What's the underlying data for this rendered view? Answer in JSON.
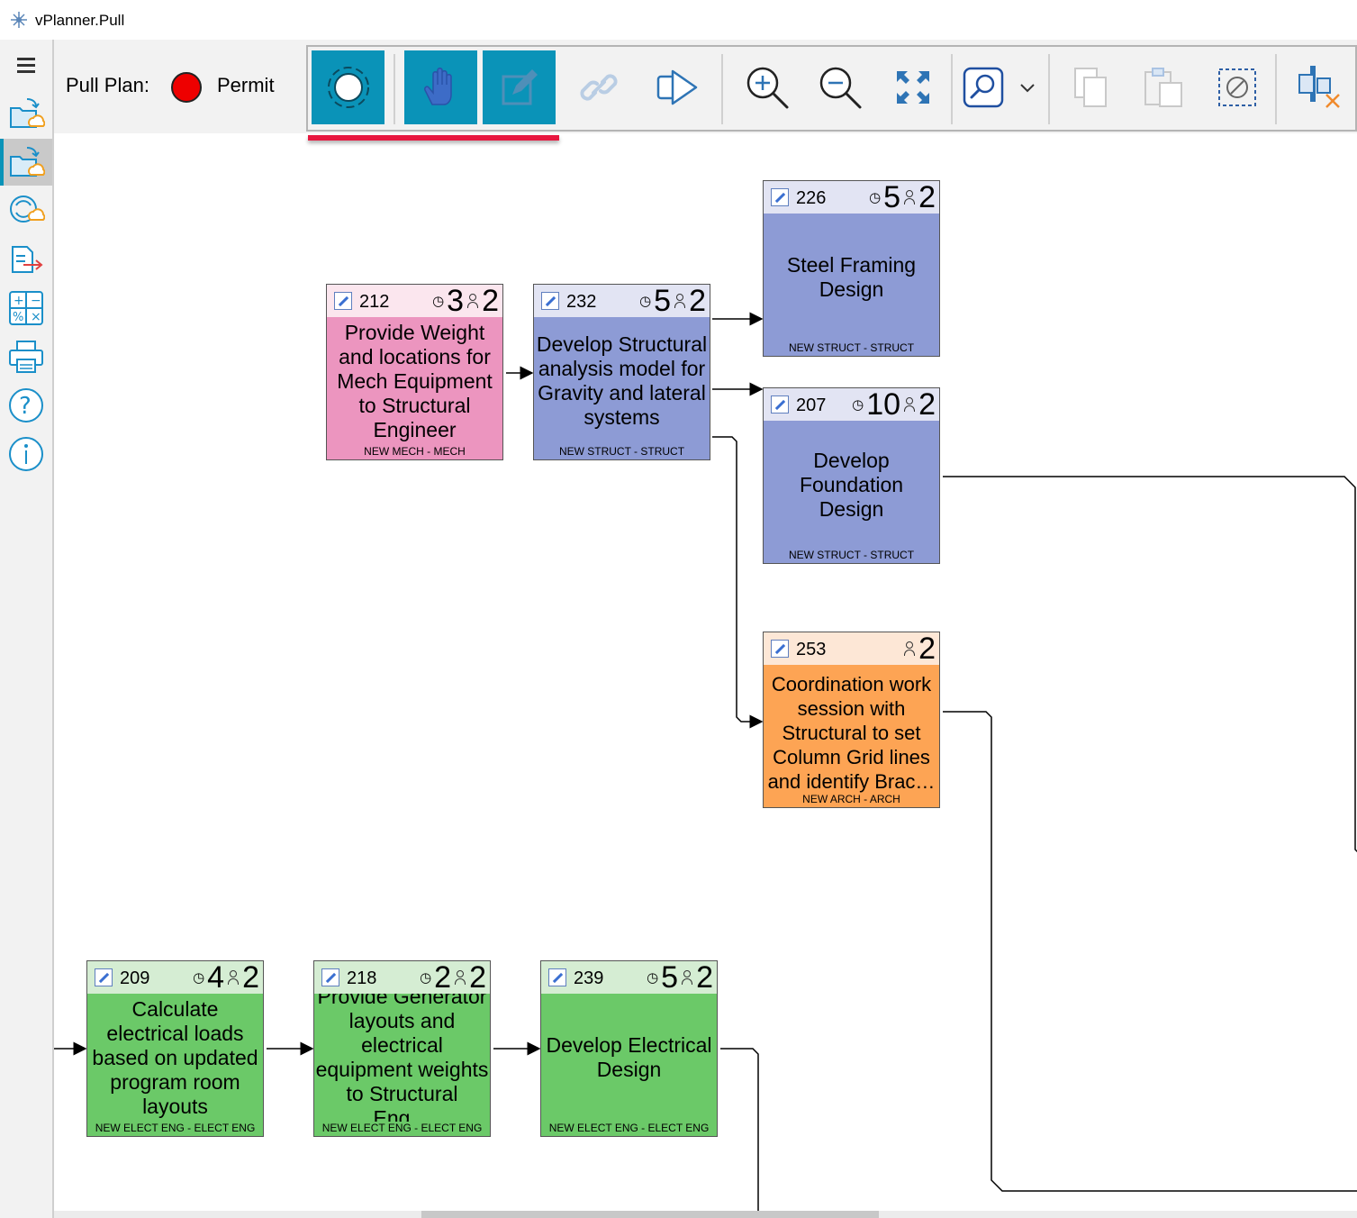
{
  "app": {
    "title": "vPlanner.Pull"
  },
  "header": {
    "pull_plan_label": "Pull Plan:",
    "plan_name": "Permit",
    "status_color": "#ee0000"
  },
  "toolbar": {
    "buttons": [
      "select-tool",
      "pan-tool",
      "edit-tool",
      "link-tool",
      "presentation-tool",
      "zoom-in",
      "zoom-out",
      "fit-to-screen",
      "search",
      "search-options-dropdown",
      "copy",
      "paste",
      "clear-selection",
      "remove-swimlane"
    ],
    "active_color": "#0a93b8",
    "highlight_color": "#e8173f"
  },
  "sidebar": {
    "items": [
      "menu",
      "open-from-cloud",
      "save-to-cloud",
      "sync",
      "export",
      "calculator",
      "print",
      "help",
      "info"
    ]
  },
  "cards": [
    {
      "id": "212",
      "duration": "3",
      "crew": "2",
      "title": "Provide Weight and locations for Mech Equipment to Structural Engineer",
      "team": "NEW MECH - MECH",
      "color": "pink"
    },
    {
      "id": "232",
      "duration": "5",
      "crew": "2",
      "title": "Develop Structural analysis model for Gravity and lateral systems",
      "team": "NEW STRUCT - STRUCT",
      "color": "blue"
    },
    {
      "id": "226",
      "duration": "5",
      "crew": "2",
      "title": "Steel Framing Design",
      "team": "NEW STRUCT - STRUCT",
      "color": "blue"
    },
    {
      "id": "207",
      "duration": "10",
      "crew": "2",
      "title": "Develop Foundation Design",
      "team": "NEW STRUCT - STRUCT",
      "color": "blue"
    },
    {
      "id": "253",
      "duration": "",
      "crew": "2",
      "title": "Coordination work session with Structural to set Column Grid lines and identify Brac…",
      "team": "NEW ARCH - ARCH",
      "color": "orange"
    },
    {
      "id": "209",
      "duration": "4",
      "crew": "2",
      "title": "Calculate electrical loads based on updated program room layouts",
      "team": "NEW ELECT ENG - ELECT ENG",
      "color": "green"
    },
    {
      "id": "218",
      "duration": "2",
      "crew": "2",
      "title": "Provide Generator layouts and electrical equipment weights to Structural Eng…",
      "team": "NEW ELECT ENG - ELECT ENG",
      "color": "green"
    },
    {
      "id": "239",
      "duration": "5",
      "crew": "2",
      "title": "Develop Electrical Design",
      "team": "NEW ELECT ENG - ELECT ENG",
      "color": "green"
    }
  ],
  "colors": {
    "pink": "#ec95bf",
    "blue": "#8d9bd5",
    "orange": "#fda454",
    "green": "#6bc968"
  }
}
